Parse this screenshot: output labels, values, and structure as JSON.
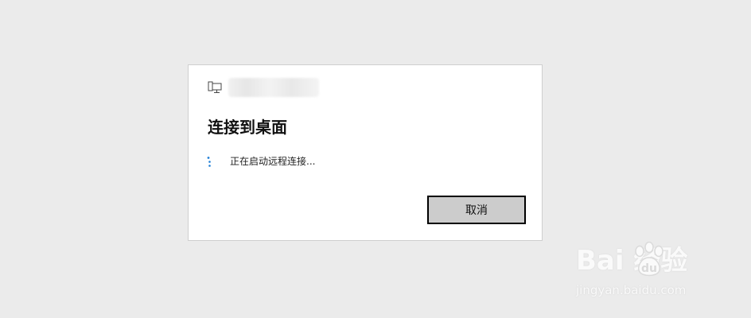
{
  "dialog": {
    "title": "连接到桌面",
    "status_text": "正在启动远程连接...",
    "cancel_label": "取消",
    "host_name": ""
  },
  "watermark": {
    "logo_text": "Bai  经验",
    "url_text": "jingyan.baidu.com"
  },
  "icons": {
    "computer": "computer-icon",
    "spinner": "loading-spinner-icon",
    "paw": "baidu-paw-icon"
  },
  "colors": {
    "background": "#ebebeb",
    "dialog": "#ffffff",
    "spinner": "#1f7fd6",
    "button": "#cccccc"
  }
}
